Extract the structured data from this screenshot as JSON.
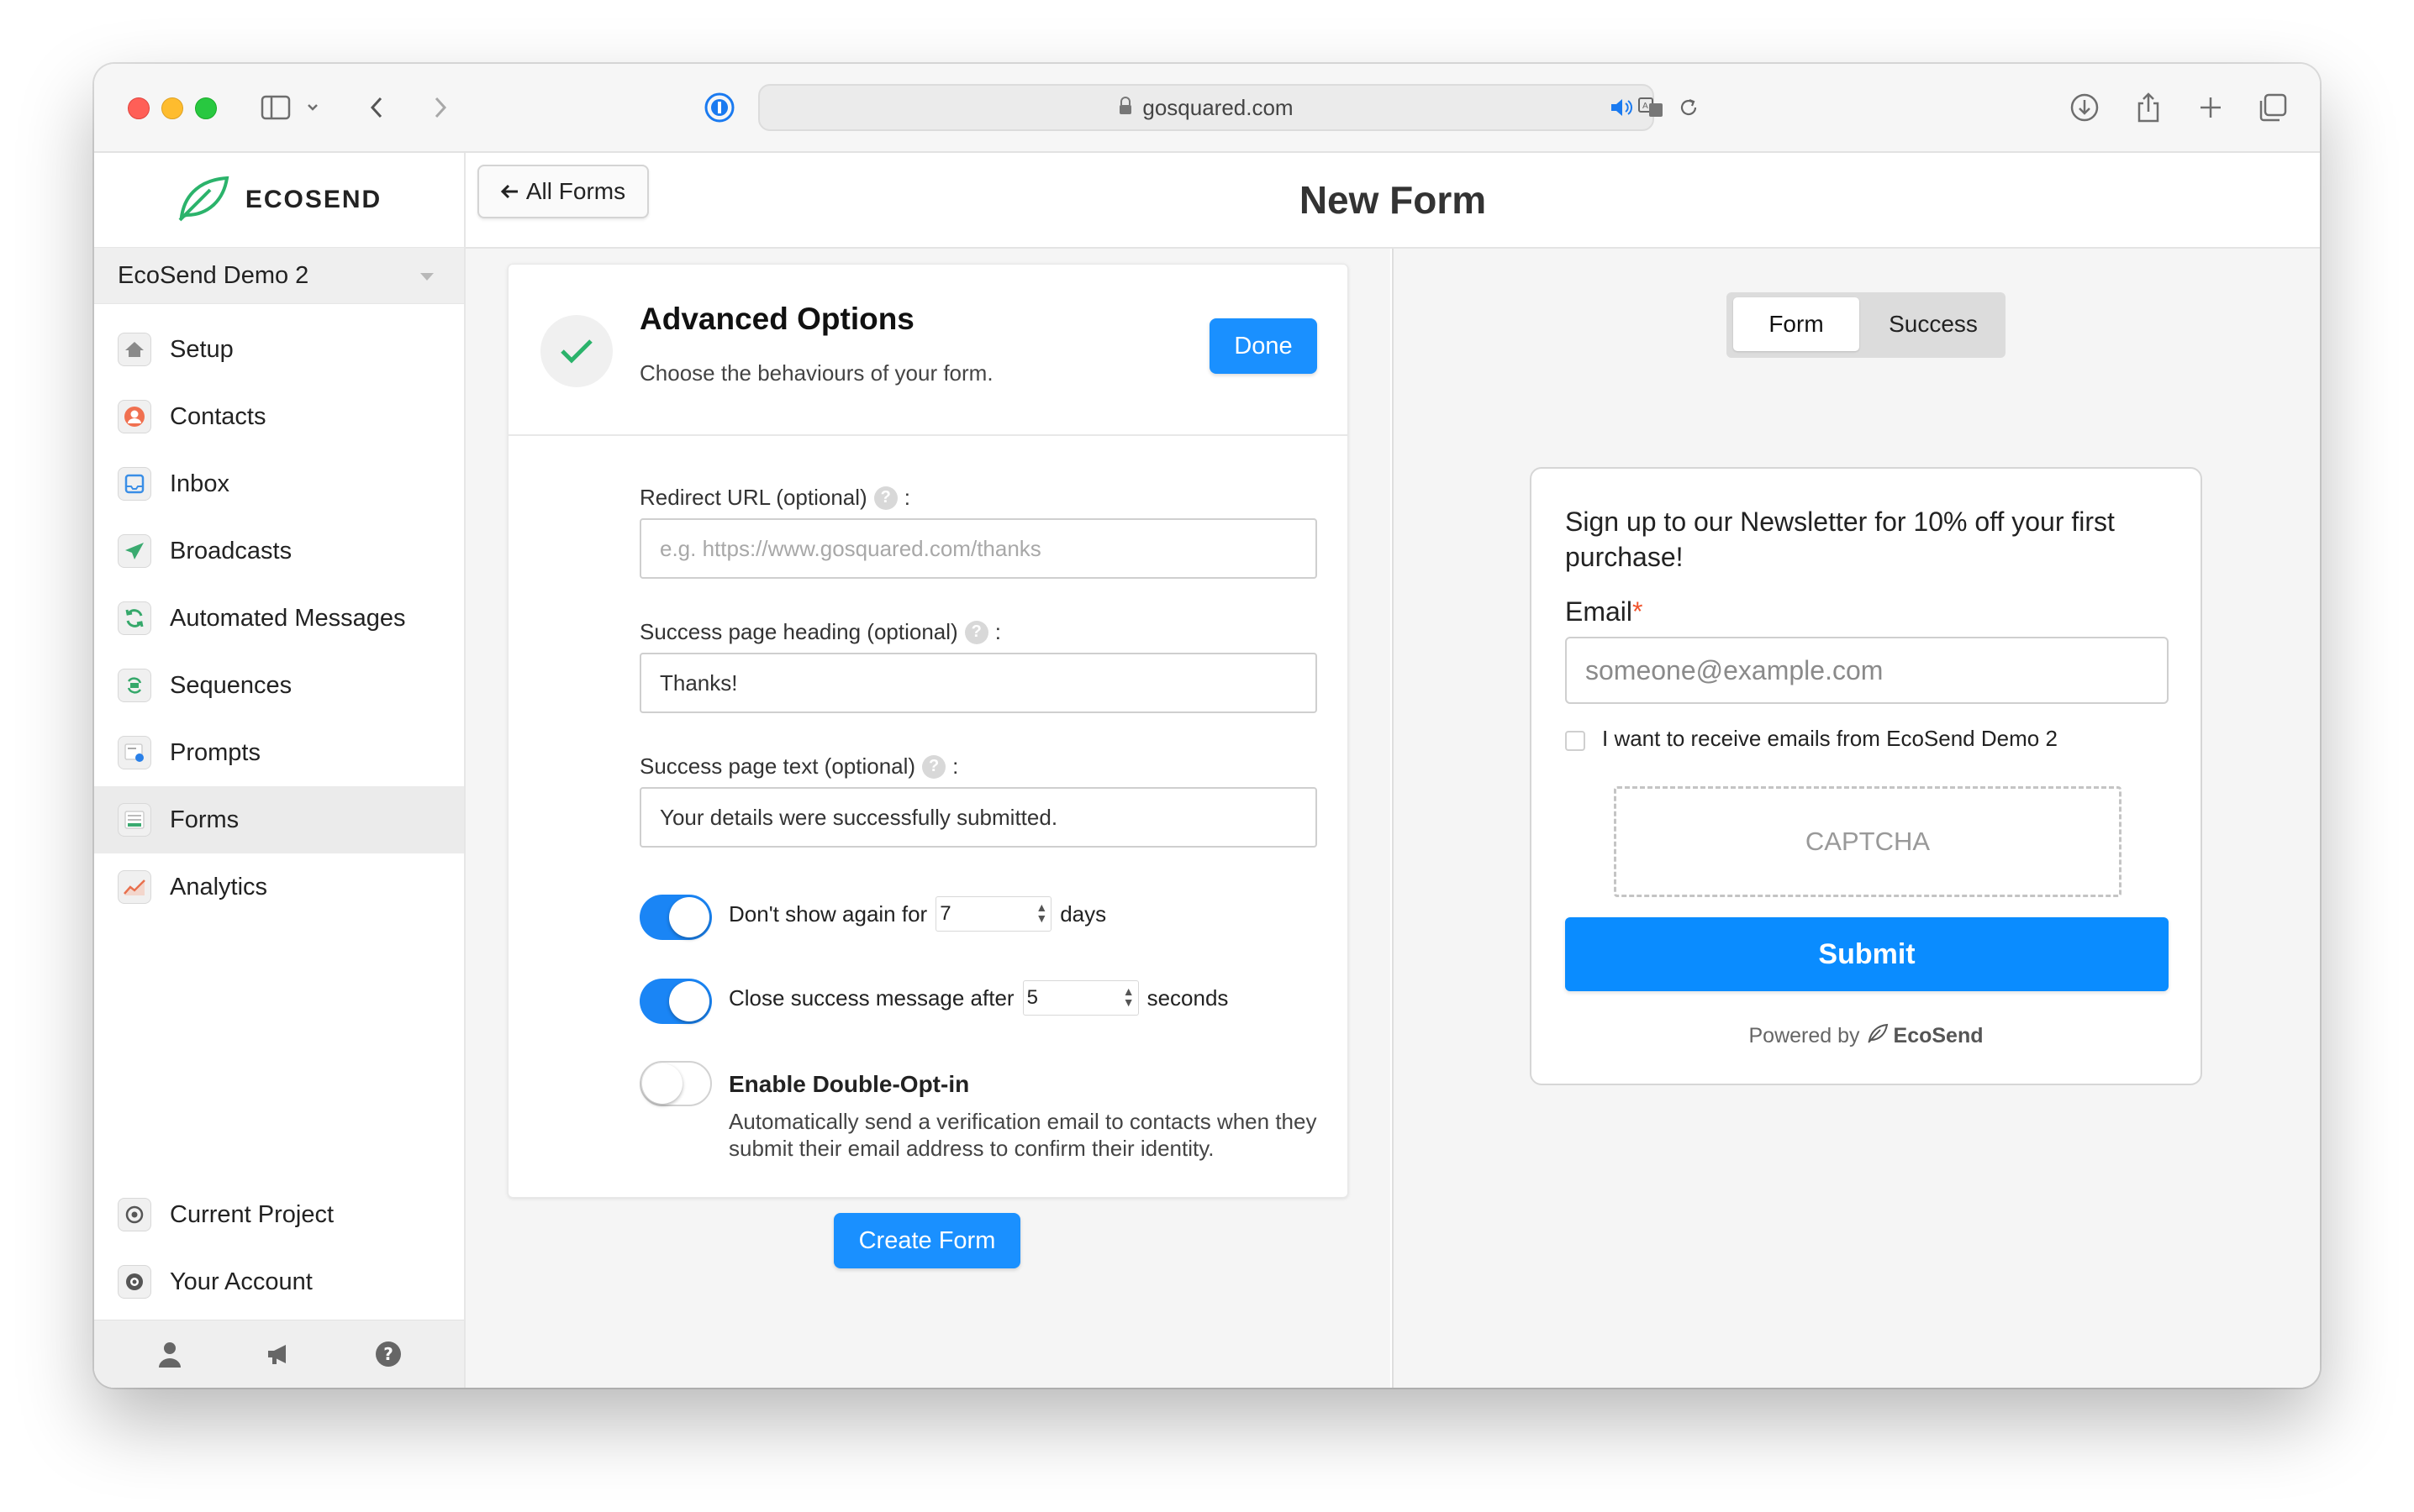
{
  "browser": {
    "url": "gosquared.com"
  },
  "sidebar": {
    "brand": "ECOSEND",
    "project": "EcoSend Demo 2",
    "items": [
      {
        "label": "Setup",
        "icon": "home-icon"
      },
      {
        "label": "Contacts",
        "icon": "contacts-icon"
      },
      {
        "label": "Inbox",
        "icon": "inbox-icon"
      },
      {
        "label": "Broadcasts",
        "icon": "paper-plane-icon"
      },
      {
        "label": "Automated Messages",
        "icon": "refresh-icon"
      },
      {
        "label": "Sequences",
        "icon": "sequence-icon"
      },
      {
        "label": "Prompts",
        "icon": "prompt-icon"
      },
      {
        "label": "Forms",
        "icon": "forms-icon",
        "active": true
      },
      {
        "label": "Analytics",
        "icon": "chart-icon"
      }
    ],
    "footer_items": [
      {
        "label": "Current Project",
        "icon": "project-icon"
      },
      {
        "label": "Your Account",
        "icon": "account-icon"
      }
    ]
  },
  "header": {
    "back_label": "All Forms",
    "title": "New Form"
  },
  "options": {
    "title": "Advanced Options",
    "subtitle": "Choose the behaviours of your form.",
    "done_label": "Done",
    "redirect_label": "Redirect URL (optional)",
    "redirect_placeholder": "e.g. https://www.gosquared.com/thanks",
    "heading_label": "Success page heading (optional)",
    "heading_value": "Thanks!",
    "text_label": "Success page text (optional)",
    "text_value": "Your details were successfully submitted.",
    "dont_show_prefix": "Don't show again for",
    "dont_show_value": "7",
    "dont_show_suffix": "days",
    "dont_show_enabled": true,
    "close_prefix": "Close success message after",
    "close_value": "5",
    "close_suffix": "seconds",
    "close_enabled": true,
    "double_opt_title": "Enable Double-Opt-in",
    "double_opt_desc": "Automatically send a verification email to contacts when they submit their email address to confirm their identity.",
    "double_opt_enabled": false,
    "create_label": "Create Form"
  },
  "preview": {
    "tabs": [
      "Form",
      "Success"
    ],
    "active_tab": "Form",
    "heading": "Sign up to our Newsletter for 10% off your first purchase!",
    "email_label": "Email",
    "required_mark": "*",
    "email_placeholder": "someone@example.com",
    "consent_label": "I want to receive emails from EcoSend Demo 2",
    "captcha": "CAPTCHA",
    "submit_label": "Submit",
    "powered_by": "Powered by",
    "powered_brand": "EcoSend"
  },
  "colors": {
    "accent": "#1a90ff",
    "brand_green": "#2bb36b",
    "required": "#f0542d"
  }
}
